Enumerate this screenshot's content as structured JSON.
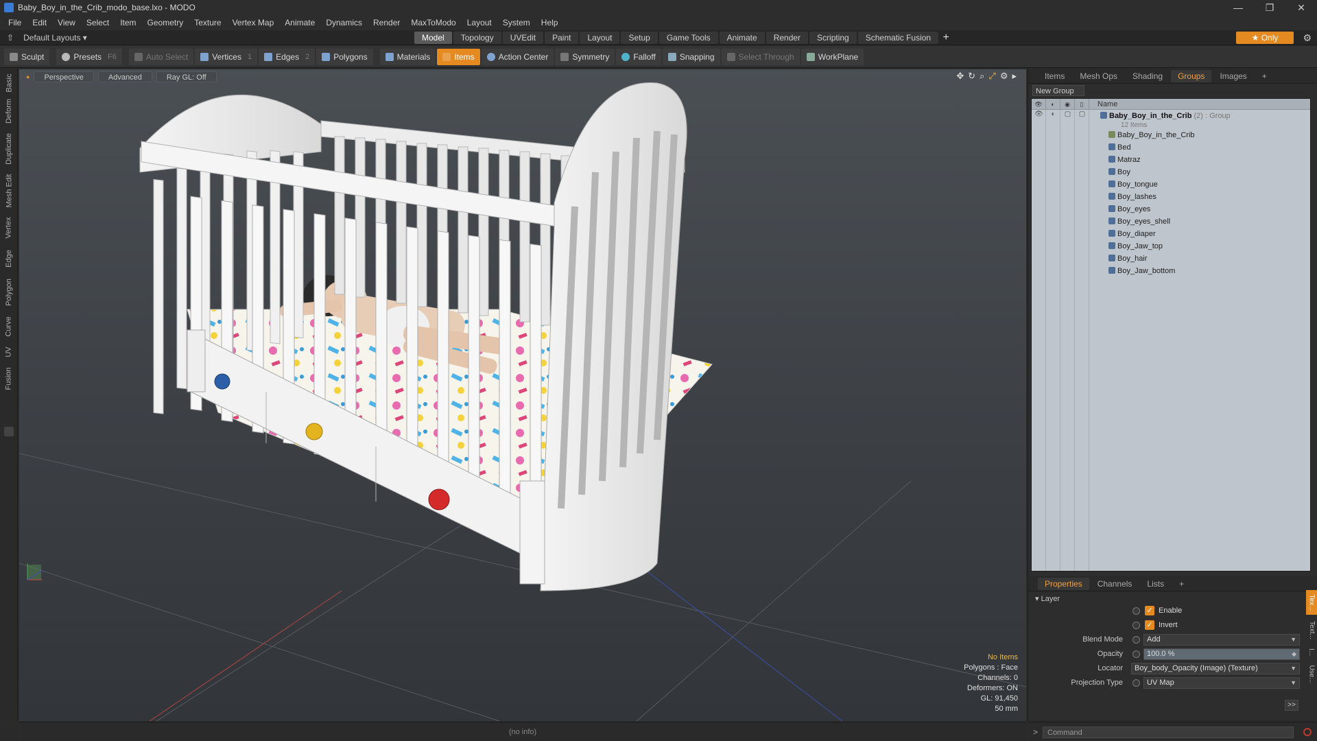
{
  "window": {
    "title": "Baby_Boy_in_the_Crib_modo_base.lxo - MODO",
    "controls": [
      "—",
      "❐",
      "✕"
    ]
  },
  "menu": [
    "File",
    "Edit",
    "View",
    "Select",
    "Item",
    "Geometry",
    "Texture",
    "Vertex Map",
    "Animate",
    "Dynamics",
    "Render",
    "MaxToModo",
    "Layout",
    "System",
    "Help"
  ],
  "layoutbar": {
    "layouts_label": "Default Layouts ▾",
    "tabs": [
      "Model",
      "Topology",
      "UVEdit",
      "Paint",
      "Layout",
      "Setup",
      "Game Tools",
      "Animate",
      "Render",
      "Scripting",
      "Schematic Fusion"
    ],
    "active_tab": "Model",
    "only_label": "★  Only"
  },
  "toolbar": {
    "sculpt": "Sculpt",
    "presets": "Presets",
    "presets_key": "F6",
    "auto_select": "Auto Select",
    "vertices": "Vertices",
    "vertices_count": "1",
    "edges": "Edges",
    "edges_count": "2",
    "polygons": "Polygons",
    "materials": "Materials",
    "items": "Items",
    "action_center": "Action Center",
    "symmetry": "Symmetry",
    "falloff": "Falloff",
    "snapping": "Snapping",
    "select_through": "Select Through",
    "workplane": "WorkPlane"
  },
  "left_tabs": [
    "Basic",
    "Deform",
    "Duplicate",
    "Mesh Edit",
    "Vertex",
    "Edge",
    "Polygon",
    "Curve",
    "UV",
    "Fusion"
  ],
  "viewport": {
    "buttons": [
      "Perspective",
      "Advanced",
      "Ray GL: Off"
    ],
    "info": {
      "no_items": "No Items",
      "polygons": "Polygons : Face",
      "channels": "Channels: 0",
      "deformers": "Deformers: ON",
      "gl": "GL: 91,450",
      "scale": "50 mm"
    }
  },
  "status": {
    "text": "(no info)"
  },
  "right_panel": {
    "tabs": [
      "Items",
      "Mesh Ops",
      "Shading",
      "Groups",
      "Images"
    ],
    "active_tab": "Groups",
    "new_group": "New Group",
    "tree_header": "Name",
    "group_name": "Baby_Boy_in_the_Crib",
    "group_suffix": " (2) : Group",
    "group_count": "12 Items",
    "items": [
      "Baby_Boy_in_the_Crib",
      "Bed",
      "Matraz",
      "Boy",
      "Boy_tongue",
      "Boy_lashes",
      "Boy_eyes",
      "Boy_eyes_shell",
      "Boy_diaper",
      "Boy_Jaw_top",
      "Boy_hair",
      "Boy_Jaw_bottom"
    ]
  },
  "properties": {
    "tabs": [
      "Properties",
      "Channels",
      "Lists"
    ],
    "active_tab": "Properties",
    "section": "Layer",
    "enable_label": "Enable",
    "invert_label": "Invert",
    "blend_mode_label": "Blend Mode",
    "blend_mode_value": "Add",
    "opacity_label": "Opacity",
    "opacity_value": "100.0 %",
    "locator_label": "Locator",
    "locator_value": "Boy_body_Opacity (Image) (Texture)",
    "projection_label": "Projection Type",
    "projection_value": "UV Map",
    "more": ">>",
    "side_tabs": [
      "Tex...",
      "Text...",
      "I...",
      "Use..."
    ]
  },
  "command": {
    "placeholder": "Command",
    "prompt": ">"
  },
  "colors": {
    "accent": "#e58a21",
    "active_tab_text": "#f0a040",
    "tree_bg": "#bfc5cc"
  }
}
